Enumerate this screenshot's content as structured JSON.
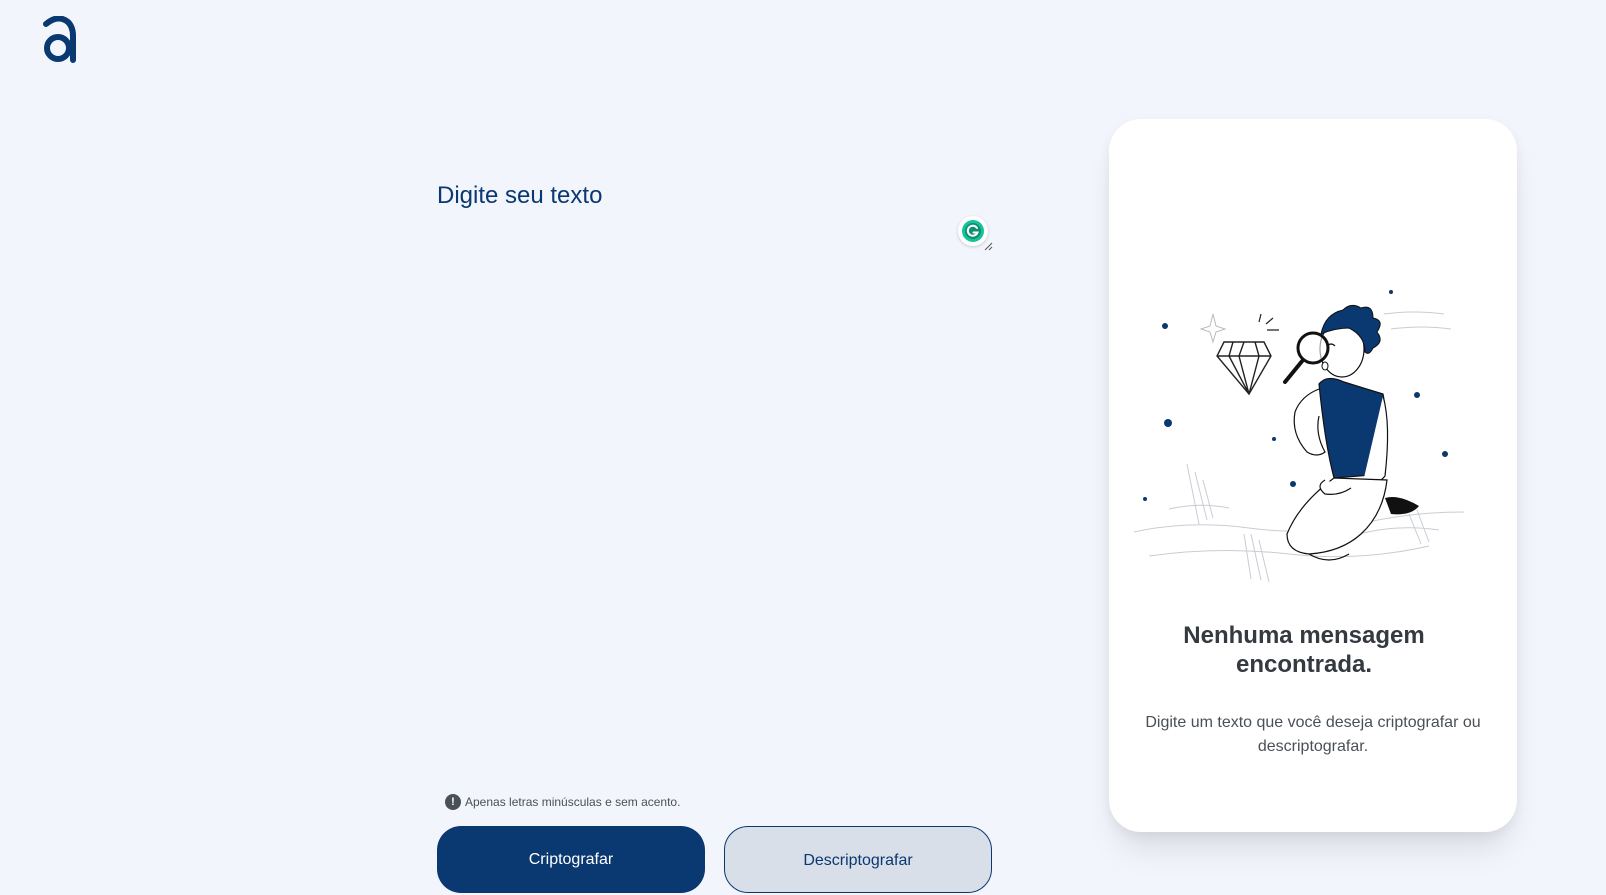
{
  "brand": {
    "logo_letter": "a",
    "color": "#0a3871"
  },
  "editor": {
    "placeholder": "Digite seu texto",
    "value": ""
  },
  "hint": {
    "icon": "alert-circle-icon",
    "text": "Apenas letras minúsculas e sem acento."
  },
  "actions": {
    "encrypt_label": "Criptografar",
    "decrypt_label": "Descriptografar"
  },
  "output_panel": {
    "title": "Nenhuma mensagem encontrada.",
    "text": "Digite um texto que você deseja criptografar ou descriptografar.",
    "illustration": "person-with-magnifier-and-diamond-illustration"
  },
  "colors": {
    "background": "#f3f5fc",
    "primary": "#0a3871",
    "secondary_button": "#d8dfe8",
    "grammarly": "#15c39a"
  }
}
